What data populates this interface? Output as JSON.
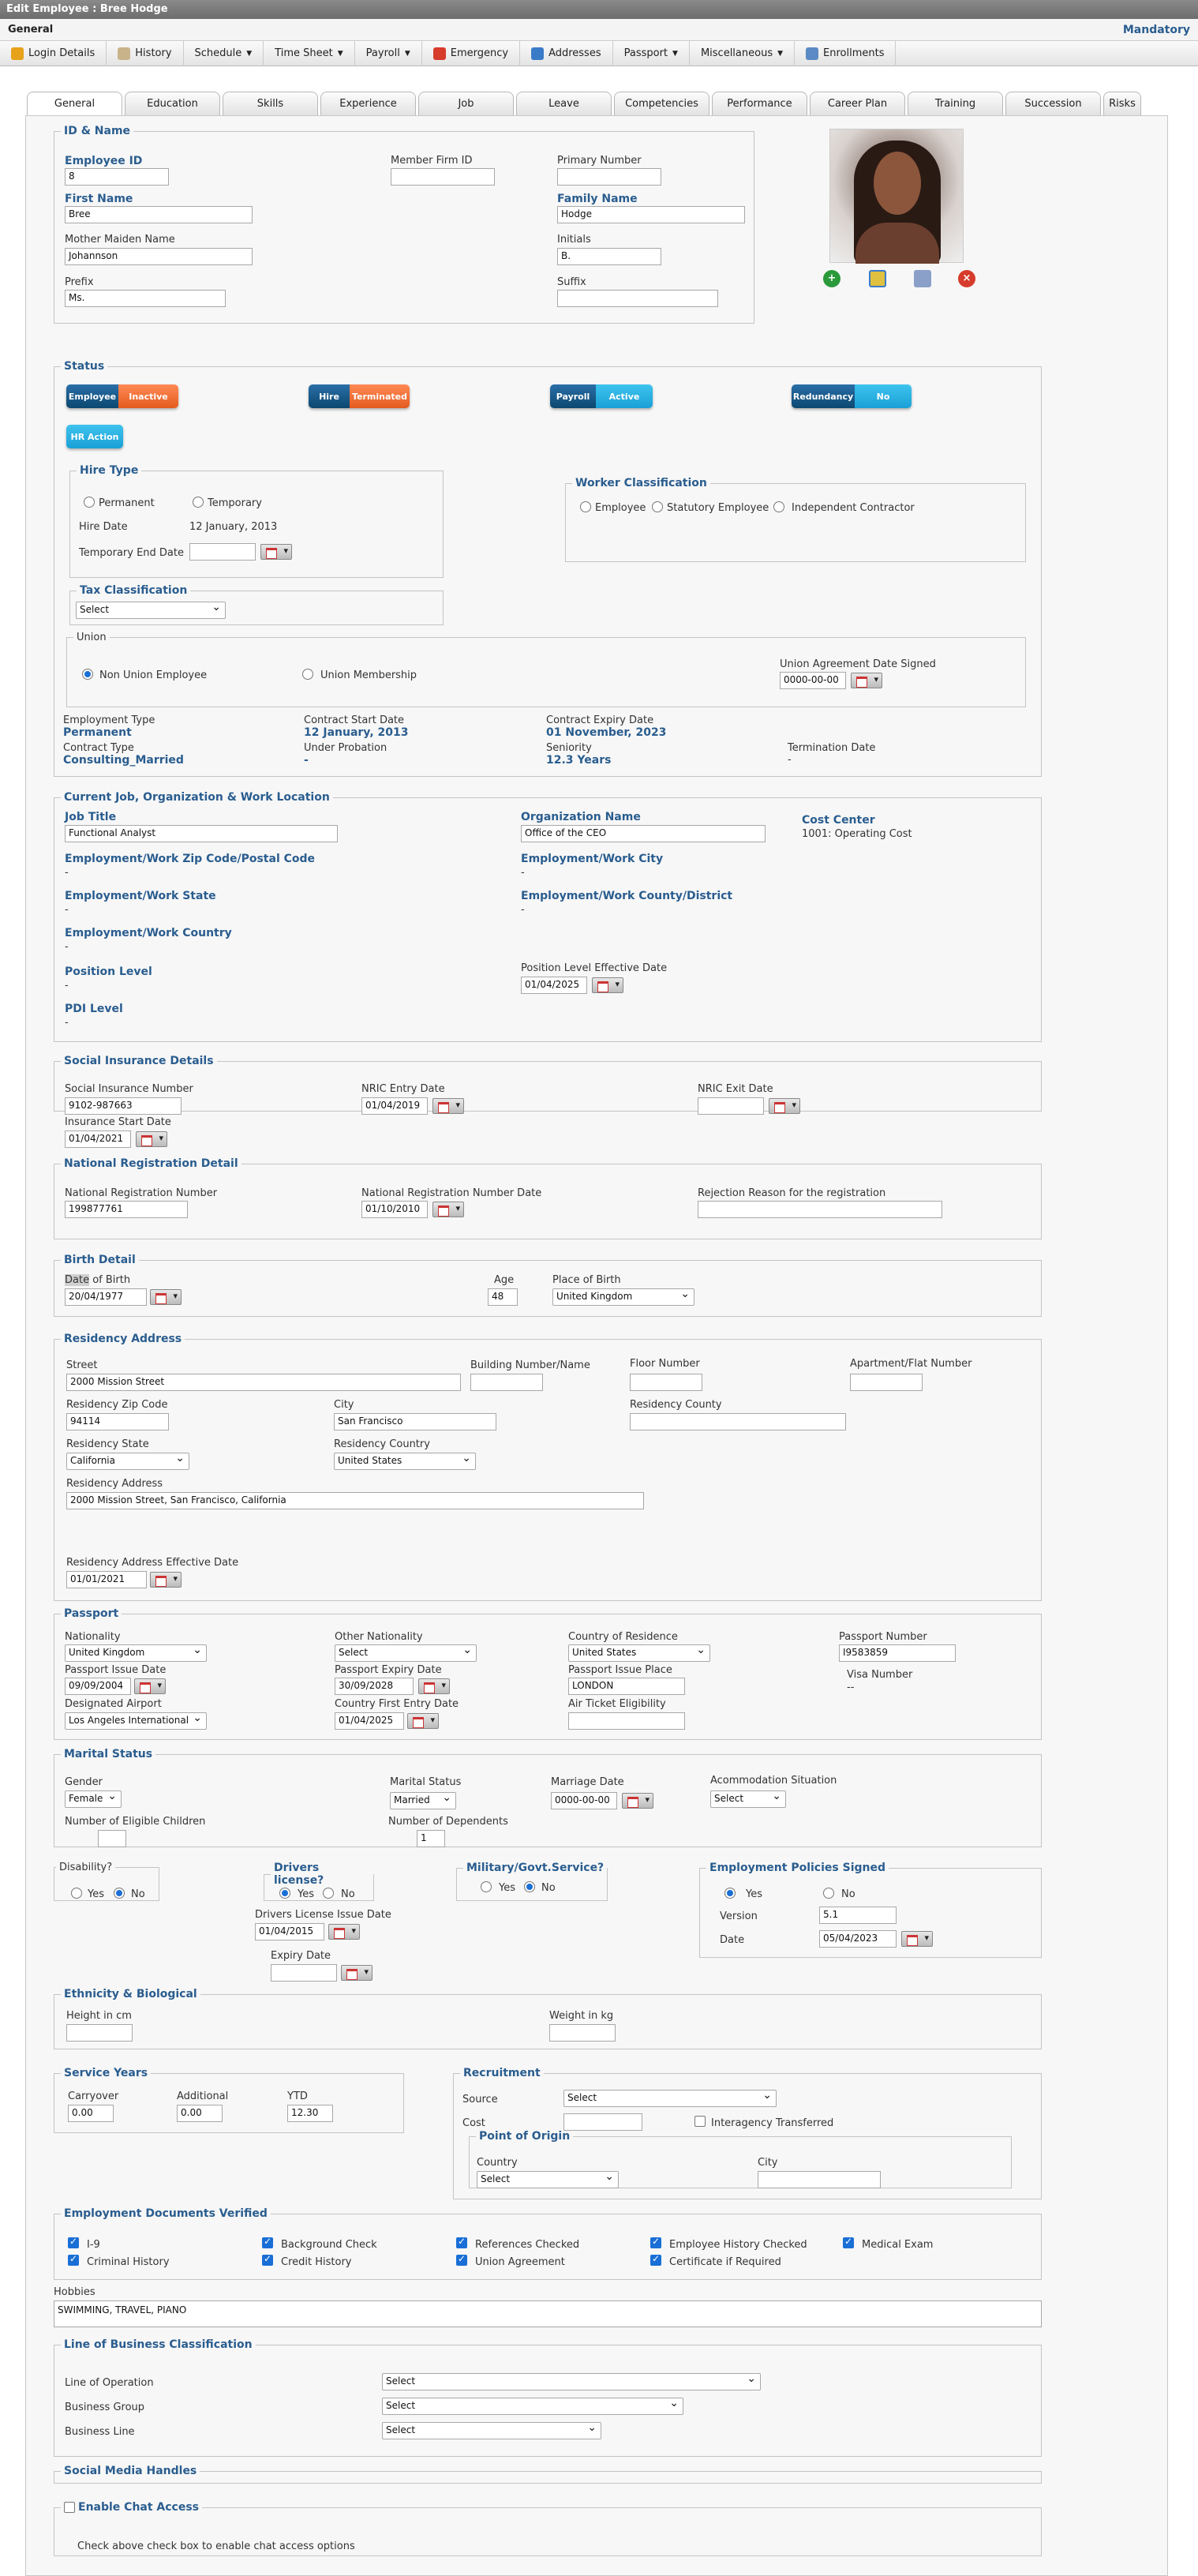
{
  "title": "Edit Employee : Bree Hodge",
  "section": "General",
  "mandatory": "Mandatory",
  "toolbar": [
    "Login Details",
    "History",
    "Schedule",
    "Time Sheet",
    "Payroll",
    "Emergency",
    "Addresses",
    "Passport",
    "Miscellaneous",
    "Enrollments"
  ],
  "tabs": [
    "General",
    "Education",
    "Skills",
    "Experience",
    "Job",
    "Leave",
    "Competencies",
    "Performance",
    "Career Plan",
    "Training",
    "Succession",
    "Risks"
  ],
  "id": {
    "legend": "ID & Name",
    "employee_id_label": "Employee ID",
    "employee_id": "8",
    "member_firm_label": "Member Firm ID",
    "member_firm": "",
    "primary_number_label": "Primary Number",
    "primary_number": "",
    "first_name_label": "First Name",
    "first_name": "Bree",
    "family_name_label": "Family Name",
    "family_name": "Hodge",
    "mother_label": "Mother Maiden Name",
    "mother": "Johannson",
    "initials_label": "Initials",
    "initials": "B.",
    "prefix_label": "Prefix",
    "prefix": "Ms.",
    "suffix_label": "Suffix",
    "suffix": ""
  },
  "status": {
    "legend": "Status",
    "toggles": [
      {
        "l": "Employee",
        "r": "Inactive"
      },
      {
        "l": "Hire",
        "r": "Terminated"
      },
      {
        "l": "Payroll",
        "r": "Active"
      },
      {
        "l": "Redundancy",
        "r": "No"
      }
    ],
    "hr_action": "HR Action"
  },
  "hire": {
    "legend": "Hire Type",
    "permanent": "Permanent",
    "temporary": "Temporary",
    "hire_date_label": "Hire Date",
    "hire_date": "12 January, 2013",
    "temp_end_label": "Temporary End Date"
  },
  "worker": {
    "legend": "Worker Classification",
    "opts": [
      "Employee",
      "Statutory Employee",
      "Independent Contractor"
    ]
  },
  "tax": {
    "legend": "Tax Classification",
    "value": "Select"
  },
  "union": {
    "legend": "Union",
    "non_union": "Non Union Employee",
    "membership": "Union Membership",
    "agreement_label": "Union Agreement Date Signed",
    "agreement": "0000-00-00"
  },
  "emp": {
    "type_label": "Employment Type",
    "type": "Permanent",
    "contract_start_label": "Contract Start Date",
    "contract_start": "12 January, 2013",
    "contract_expiry_label": "Contract Expiry Date",
    "contract_expiry": "01 November, 2023",
    "contract_type_label": "Contract Type",
    "contract_type": "Consulting_Married",
    "probation_label": "Under Probation",
    "probation": "-",
    "seniority_label": "Seniority",
    "seniority": "12.3 Years",
    "termination_label": "Termination Date",
    "termination": "-"
  },
  "job": {
    "legend": "Current Job, Organization & Work Location",
    "title_label": "Job Title",
    "title": "Functional Analyst",
    "org_label": "Organization Name",
    "org": "Office of the CEO",
    "cost_label": "Cost Center",
    "cost": "1001: Operating Cost",
    "zip_label": "Employment/Work Zip Code/Postal Code",
    "zip": "-",
    "city_label": "Employment/Work City",
    "city": "-",
    "state_label": "Employment/Work State",
    "state": "-",
    "county_label": "Employment/Work County/District",
    "county": "-",
    "country_label": "Employment/Work Country",
    "country": "-",
    "pos_label": "Position Level",
    "pos": "-",
    "pos_eff_label": "Position Level Effective Date",
    "pos_eff": "01/04/2025",
    "pdi_label": "PDI Level",
    "pdi": "-"
  },
  "social": {
    "legend": "Social Insurance Details",
    "sin_label": "Social Insurance Number",
    "sin": "9102-987663",
    "nric_entry_label": "NRIC Entry Date",
    "nric_entry": "01/04/2019",
    "nric_exit_label": "NRIC Exit Date",
    "nric_exit": "",
    "ins_start_label": "Insurance Start Date",
    "ins_start": "01/04/2021"
  },
  "natreg": {
    "legend": "National Registration Detail",
    "num_label": "National Registration Number",
    "num": "199877761",
    "date_label": "National Registration Number Date",
    "date": "01/10/2010",
    "reason_label": "Rejection Reason for the registration",
    "reason": ""
  },
  "birth": {
    "legend": "Birth Detail",
    "dob_label_a": "Date",
    "dob_label_b": " of Birth",
    "dob": "20/04/1977",
    "age_label": "Age",
    "age": "48",
    "pob_label": "Place of Birth",
    "pob": "United Kingdom"
  },
  "res": {
    "legend": "Residency Address",
    "street_label": "Street",
    "street": "2000 Mission Street",
    "bldg_label": "Building Number/Name",
    "floor_label": "Floor Number",
    "apt_label": "Apartment/Flat Number",
    "zip_label": "Residency Zip Code",
    "zip": "94114",
    "city_label": "City",
    "city": "San Francisco",
    "county_label": "Residency County",
    "state_label": "Residency State",
    "state": "California",
    "country_label": "Residency Country",
    "country": "United States",
    "addr_label": "Residency Address",
    "addr": "2000 Mission Street, San Francisco, California",
    "eff_label": "Residency Address Effective Date",
    "eff": "01/01/2021"
  },
  "passport": {
    "legend": "Passport",
    "nat_label": "Nationality",
    "nat": "United Kingdom",
    "other_label": "Other Nationality",
    "other": "Select",
    "cor_label": "Country of Residence",
    "cor": "United States",
    "num_label": "Passport Number",
    "num": "I9583859",
    "issue_label": "Passport Issue Date",
    "issue": "09/09/2004",
    "expiry_label": "Passport Expiry Date",
    "expiry": "30/09/2028",
    "place_label": "Passport Issue Place",
    "place": "LONDON",
    "visa_label": "Visa Number",
    "visa": "--",
    "airport_label": "Designated Airport",
    "airport": "Los Angeles International",
    "first_entry_label": "Country First Entry Date",
    "first_entry": "01/04/2025",
    "ticket_label": "Air Ticket Eligibility"
  },
  "marital": {
    "legend": "Marital Status",
    "gender_label": "Gender",
    "gender": "Female",
    "status_label": "Marital Status",
    "status": "Married",
    "marriage_label": "Marriage Date",
    "marriage": "0000-00-00",
    "accom_label": "Acommodation Situation",
    "accom": "Select",
    "children_label": "Number of Eligible Children",
    "dependents_label": "Number of Dependents",
    "dependents": "1"
  },
  "disability": {
    "legend": "Disability?",
    "yes": "Yes",
    "no": "No"
  },
  "drivers": {
    "legend": "Drivers license?",
    "yes": "Yes",
    "no": "No",
    "issue_label": "Drivers License Issue Date",
    "issue": "01/04/2015",
    "expiry_label": "Expiry Date"
  },
  "military": {
    "legend": "Military/Govt.Service?",
    "yes": "Yes",
    "no": "No"
  },
  "policies": {
    "legend": "Employment Policies Signed",
    "yes": "Yes",
    "no": "No",
    "version_label": "Version",
    "version": "5.1",
    "date_label": "Date",
    "date": "05/04/2023"
  },
  "ethnic": {
    "legend": "Ethnicity & Biological",
    "height_label": "Height in cm",
    "weight_label": "Weight in kg"
  },
  "service": {
    "legend": "Service Years",
    "carry_label": "Carryover",
    "carry": "0.00",
    "add_label": "Additional",
    "add": "0.00",
    "ytd_label": "YTD",
    "ytd": "12.30"
  },
  "recruit": {
    "legend": "Recruitment",
    "source_label": "Source",
    "source": "Select",
    "cost_label": "Cost",
    "interagency": "Interagency Transferred",
    "origin_legend": "Point of Origin",
    "country_label": "Country",
    "country": "Select",
    "city_label": "City"
  },
  "docs": {
    "legend": "Employment Documents Verified",
    "items": [
      "I-9",
      "Background Check",
      "References Checked",
      "Employee History Checked",
      "Medical Exam",
      "Criminal History",
      "Credit History",
      "Union Agreement",
      "Certificate if Required"
    ]
  },
  "hobbies": {
    "label": "Hobbies",
    "value": "SWIMMING, TRAVEL, PIANO"
  },
  "lob": {
    "legend": "Line of Business Classification",
    "op_label": "Line of Operation",
    "op": "Select",
    "group_label": "Business Group",
    "group": "Select",
    "line_label": "Business Line",
    "line": "Select"
  },
  "social_media": {
    "legend": "Social Media Handles"
  },
  "chat": {
    "legend": "Enable Chat Access",
    "hint": "Check above check box to enable chat access options"
  }
}
